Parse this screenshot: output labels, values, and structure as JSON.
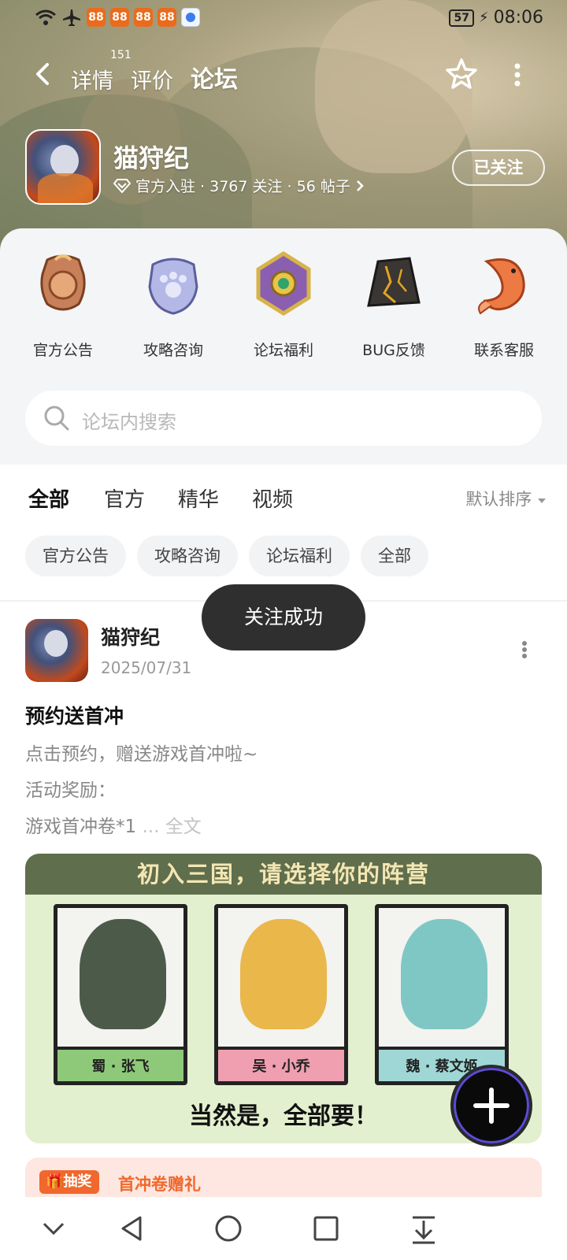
{
  "status_bar": {
    "time": "08:06",
    "battery": "57",
    "notification_apps": [
      "88",
      "88",
      "88",
      "88",
      ""
    ]
  },
  "nav": {
    "tabs": [
      {
        "label": "详情",
        "active": false
      },
      {
        "label": "评价",
        "active": false
      },
      {
        "label": "论坛",
        "active": true
      }
    ],
    "review_count": "151"
  },
  "forum": {
    "name": "猫狩纪",
    "meta": "官方入驻 · 3767 关注 · 56 帖子",
    "follow_label": "已关注"
  },
  "entries": [
    {
      "label": "官方公告",
      "icon": "announcement-badge-icon"
    },
    {
      "label": "攻略咨询",
      "icon": "paw-badge-icon"
    },
    {
      "label": "论坛福利",
      "icon": "gem-badge-icon"
    },
    {
      "label": "BUG反馈",
      "icon": "stone-icon"
    },
    {
      "label": "联系客服",
      "icon": "koi-fish-icon"
    }
  ],
  "search": {
    "placeholder": "论坛内搜索"
  },
  "feed_tabs": [
    {
      "label": "全部",
      "active": true
    },
    {
      "label": "官方",
      "active": false
    },
    {
      "label": "精华",
      "active": false
    },
    {
      "label": "视频",
      "active": false
    }
  ],
  "sort_label": "默认排序",
  "chips": [
    "官方公告",
    "攻略咨询",
    "论坛福利",
    "全部"
  ],
  "post": {
    "author": "猫狩纪",
    "date": "2025/07/31",
    "title": "预约送首冲",
    "lines": [
      "点击预约，赠送游戏首冲啦~",
      "活动奖励：",
      "游戏首冲卷*1"
    ],
    "more": " ... 全文",
    "image": {
      "banner": "初入三国，请选择你的阵营",
      "heroes": [
        {
          "name": "蜀 · 张飞",
          "color": "#8ec97a"
        },
        {
          "name": "吴 · 小乔",
          "color": "#ef9fb0"
        },
        {
          "name": "魏 · 蔡文姬",
          "color": "#9fd7d6"
        }
      ],
      "footer": "当然是，全部要！"
    }
  },
  "lottery": {
    "tag": "抽奖",
    "title": "首冲卷赠礼"
  },
  "toast": "关注成功",
  "colors": {
    "accent": "#29c7b5",
    "lottery": "#f0682d"
  }
}
